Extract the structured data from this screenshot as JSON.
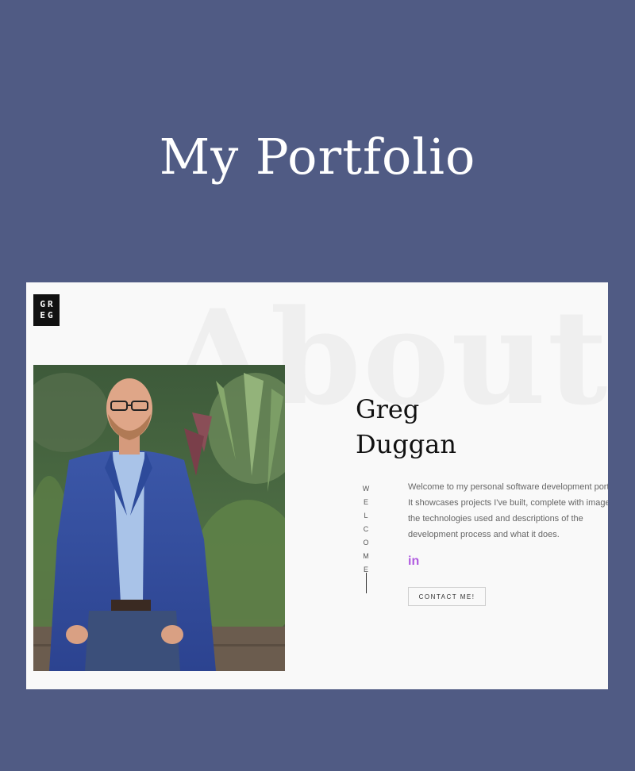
{
  "header": {
    "title": "My Portfolio"
  },
  "site": {
    "logo_line1": "GR",
    "logo_line2": "EG",
    "bg_word": "About",
    "name_first": "Greg",
    "name_last": "Duggan",
    "welcome": "WELCOME",
    "intro": "Welcome to my personal software development portfolio. It showcases projects I've built, complete with images, the technologies used and descriptions of the development process and what it does.",
    "linkedin_label": "in",
    "contact_label": "CONTACT ME!"
  },
  "colors": {
    "background": "#505b84",
    "screenshot_bg": "#f9f9f9",
    "accent": "#b05be0"
  },
  "icons": {
    "linkedin": "linkedin-icon"
  }
}
